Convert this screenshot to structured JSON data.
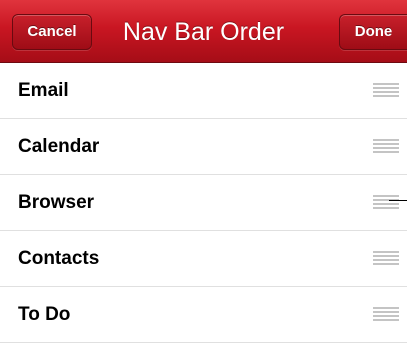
{
  "navbar": {
    "title": "Nav Bar Order",
    "cancel_label": "Cancel",
    "done_label": "Done",
    "accent_color": "#c91622"
  },
  "list": {
    "items": [
      {
        "label": "Email",
        "handle_icon": "reorder-grip-icon"
      },
      {
        "label": "Calendar",
        "handle_icon": "reorder-grip-icon"
      },
      {
        "label": "Browser",
        "handle_icon": "reorder-grip-icon"
      },
      {
        "label": "Contacts",
        "handle_icon": "reorder-grip-icon"
      },
      {
        "label": "To Do",
        "handle_icon": "reorder-grip-icon"
      }
    ]
  }
}
